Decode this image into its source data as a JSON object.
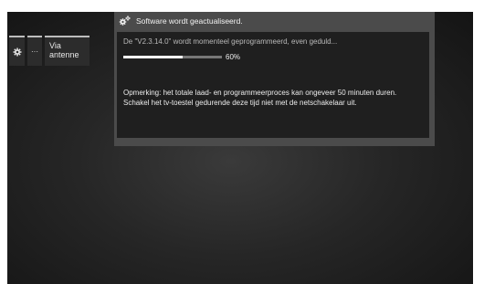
{
  "menu": {
    "items": [
      {
        "icon": "gear-icon"
      },
      {
        "label": "···"
      },
      {
        "label_line1": "Via",
        "label_line2": "antenne"
      }
    ]
  },
  "dialog": {
    "title": "Software wordt geactualiseerd.",
    "title_icon": "gears-icon",
    "status": "De \"V2.3.14.0\" wordt momenteel geprogrammeerd, even geduld...",
    "progress_percent": 60,
    "progress_label": "60%",
    "note": "Opmerking: het totale laad- en programmeerproces kan ongeveer 50 minuten duren. Schakel het tv-toestel gedurende deze tijd niet met de netschakelaar uit."
  },
  "colors": {
    "panel": "#4b4b4b",
    "panel_body": "#1f1f1f",
    "progress_fill": "#ffffff",
    "progress_track": "#777777"
  }
}
